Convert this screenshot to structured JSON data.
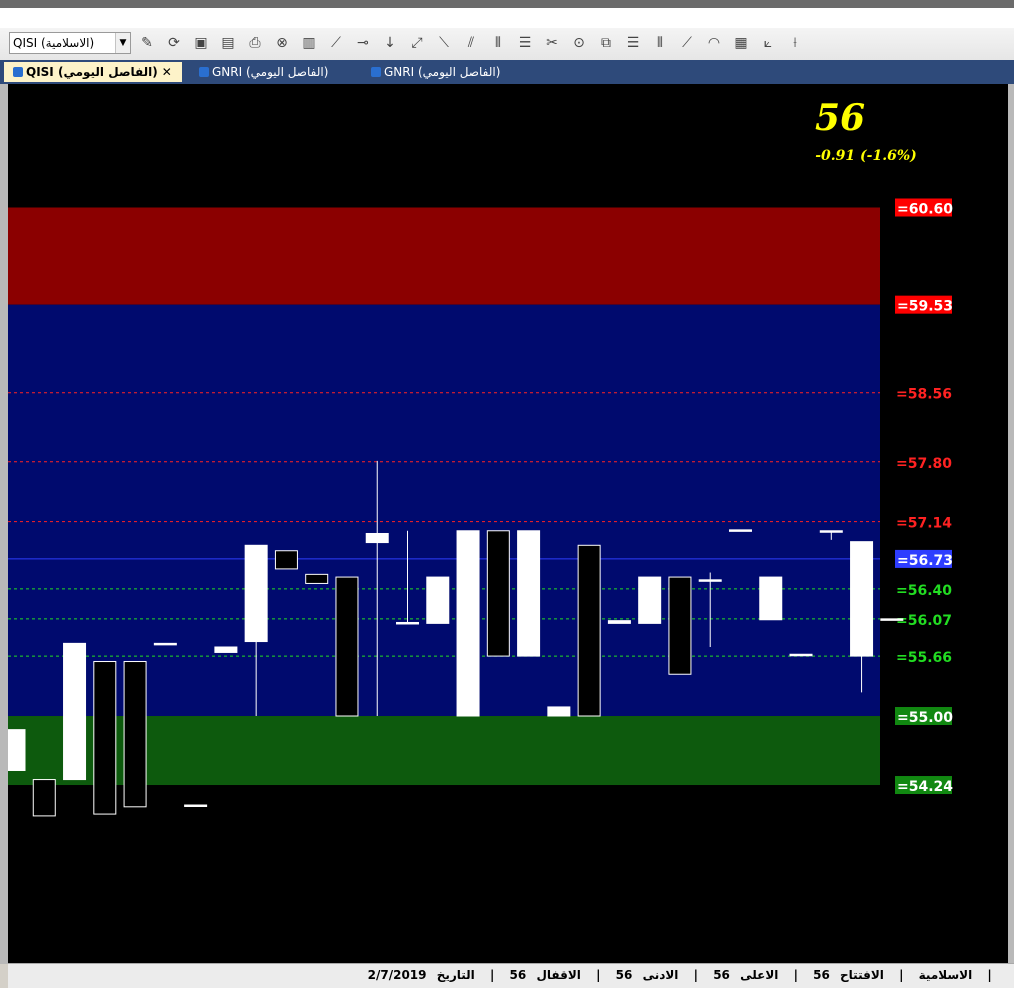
{
  "toolbar": {
    "symbol_value": "QISI (الاسلامية)",
    "icons": [
      "wand-icon",
      "refresh-icon",
      "add-chart-icon",
      "chart-settings-icon",
      "print-icon",
      "stop-icon",
      "indicator-icon",
      "trend-line-icon",
      "horizontal-line-icon",
      "vertical-arrow-icon",
      "ray-icon",
      "parallel-lines-icon",
      "diagonal-lines-icon",
      "triple-vertical-icon",
      "horizontal-bands-icon",
      "eraser-icon",
      "circle-icon",
      "copy-icon",
      "horizontal-lines-icon",
      "bars-icon",
      "fibonacci-fan-icon",
      "arc-icon",
      "grid-icon",
      "angle-icon",
      "channel-icon"
    ]
  },
  "tabs": [
    {
      "label": "QISI (الفاصل اليومي)",
      "active": true
    },
    {
      "label": "GNRI (الفاصل اليومي)",
      "active": false
    },
    {
      "label": "GNRI (الفاصل اليومي)",
      "active": false
    }
  ],
  "quote": {
    "price": "56",
    "change": "-0.91  (-1.6%)",
    "price_color": "#ffff00"
  },
  "colors": {
    "background": "#000000",
    "zone_top": "#8b0000",
    "zone_middle": "#000a6e",
    "zone_bottom": "#0d5a0d",
    "current_line": "#2e3dff",
    "candle_up": "#ffffff",
    "candle_down": "#000000"
  },
  "chart_data": {
    "type": "candlestick",
    "ylim": [
      52.28,
      61.96
    ],
    "zones": [
      {
        "from": 59.53,
        "to": 60.6,
        "color": "#8b0000"
      },
      {
        "from": 55.0,
        "to": 59.53,
        "color": "#000a6e"
      },
      {
        "from": 54.24,
        "to": 55.0,
        "color": "#0d5a0d"
      }
    ],
    "levels": [
      {
        "label": "=60.60",
        "value": 60.6,
        "style": "box",
        "color": "#ff0000"
      },
      {
        "label": "=59.53",
        "value": 59.53,
        "style": "box",
        "color": "#ff0000"
      },
      {
        "label": "=58.56",
        "value": 58.56,
        "style": "dotted",
        "color": "#ff2222"
      },
      {
        "label": "=57.80",
        "value": 57.8,
        "style": "dotted",
        "color": "#ff2222"
      },
      {
        "label": "=57.14",
        "value": 57.14,
        "style": "dotted",
        "color": "#ff2222"
      },
      {
        "label": "=56.73",
        "value": 56.73,
        "style": "solid-box",
        "color": "#2e3dff"
      },
      {
        "label": "=56.40",
        "value": 56.4,
        "style": "dotted",
        "color": "#22dd22"
      },
      {
        "label": "=56.07",
        "value": 56.07,
        "style": "dotted",
        "color": "#22dd22"
      },
      {
        "label": "=55.66",
        "value": 55.66,
        "style": "dotted",
        "color": "#22dd22"
      },
      {
        "label": "=55.00",
        "value": 55.0,
        "style": "box",
        "color": "#118811"
      },
      {
        "label": "=54.24",
        "value": 54.24,
        "style": "box",
        "color": "#118811"
      }
    ],
    "candles": [
      {
        "o": 54.4,
        "h": 54.85,
        "l": 54.4,
        "c": 54.85
      },
      {
        "o": 54.3,
        "h": 54.3,
        "l": 53.9,
        "c": 53.9
      },
      {
        "o": 54.3,
        "h": 55.8,
        "l": 54.3,
        "c": 55.8
      },
      {
        "o": 55.6,
        "h": 55.6,
        "l": 53.92,
        "c": 53.92
      },
      {
        "o": 55.6,
        "h": 55.6,
        "l": 54.0,
        "c": 54.0
      },
      {
        "o": 55.8,
        "h": 55.8,
        "l": 55.8,
        "c": 55.8
      },
      {
        "o": 54.02,
        "h": 54.02,
        "l": 54.02,
        "c": 54.02
      },
      {
        "o": 55.7,
        "h": 55.76,
        "l": 55.7,
        "c": 55.76
      },
      {
        "o": 55.82,
        "h": 56.88,
        "l": 55.0,
        "c": 56.88
      },
      {
        "o": 56.82,
        "h": 56.82,
        "l": 56.62,
        "c": 56.62
      },
      {
        "o": 56.56,
        "h": 56.56,
        "l": 56.46,
        "c": 56.46
      },
      {
        "o": 56.53,
        "h": 56.53,
        "l": 55.0,
        "c": 55.0
      },
      {
        "o": 56.91,
        "h": 57.81,
        "l": 55.0,
        "c": 57.01
      },
      {
        "o": 56.03,
        "h": 57.04,
        "l": 56.03,
        "c": 56.03
      },
      {
        "o": 56.02,
        "h": 56.53,
        "l": 56.02,
        "c": 56.53
      },
      {
        "o": 55.0,
        "h": 57.04,
        "l": 55.0,
        "c": 57.04
      },
      {
        "o": 57.04,
        "h": 57.04,
        "l": 55.66,
        "c": 55.66
      },
      {
        "o": 55.66,
        "h": 57.04,
        "l": 55.66,
        "c": 57.04
      },
      {
        "o": 55.0,
        "h": 55.1,
        "l": 55.0,
        "c": 55.1
      },
      {
        "o": 56.88,
        "h": 56.88,
        "l": 55.0,
        "c": 55.0
      },
      {
        "o": 56.02,
        "h": 56.05,
        "l": 56.02,
        "c": 56.05
      },
      {
        "o": 56.02,
        "h": 56.53,
        "l": 56.02,
        "c": 56.53
      },
      {
        "o": 56.53,
        "h": 56.53,
        "l": 55.46,
        "c": 55.46
      },
      {
        "o": 56.5,
        "h": 56.58,
        "l": 55.76,
        "c": 56.5
      },
      {
        "o": 57.05,
        "h": 57.05,
        "l": 57.05,
        "c": 57.05
      },
      {
        "o": 56.06,
        "h": 56.53,
        "l": 56.06,
        "c": 56.53
      },
      {
        "o": 55.68,
        "h": 55.68,
        "l": 55.68,
        "c": 55.68
      },
      {
        "o": 57.04,
        "h": 57.04,
        "l": 56.94,
        "c": 57.04
      },
      {
        "o": 55.66,
        "h": 56.92,
        "l": 55.26,
        "c": 56.92
      },
      {
        "o": 56.07,
        "h": 56.07,
        "l": 56.07,
        "c": 56.07
      }
    ]
  },
  "status": {
    "symbol": "الاسلامية",
    "open_label": "الافتتاح",
    "open": "56",
    "high_label": "الاعلى",
    "high": "56",
    "low_label": "الادنى",
    "low": "56",
    "close_label": "الاقفال",
    "close": "56",
    "date_label": "التاريخ",
    "date": "2/7/2019"
  }
}
